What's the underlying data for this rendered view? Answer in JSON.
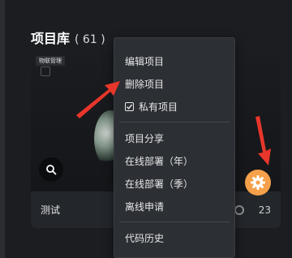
{
  "header": {
    "title": "项目库",
    "count": "( 61 )"
  },
  "card": {
    "badge": "物联管理",
    "name": "测试",
    "count": "23"
  },
  "menu": {
    "items": [
      {
        "label": "编辑项目"
      },
      {
        "label": "删除项目"
      },
      {
        "label": "私有项目",
        "checked": true
      },
      {
        "label": "项目分享"
      },
      {
        "label": "在线部署（年）"
      },
      {
        "label": "在线部署（季）"
      },
      {
        "label": "离线申请"
      },
      {
        "label": "代码历史"
      }
    ]
  },
  "colors": {
    "accent": "#f5a04a",
    "arrow": "#e8362b",
    "background": "#1b1d21",
    "menu_bg": "#2c2f34"
  },
  "icons": {
    "search": "search-icon",
    "gear": "gear-icon",
    "clock": "clock-icon",
    "check": "check-icon"
  }
}
